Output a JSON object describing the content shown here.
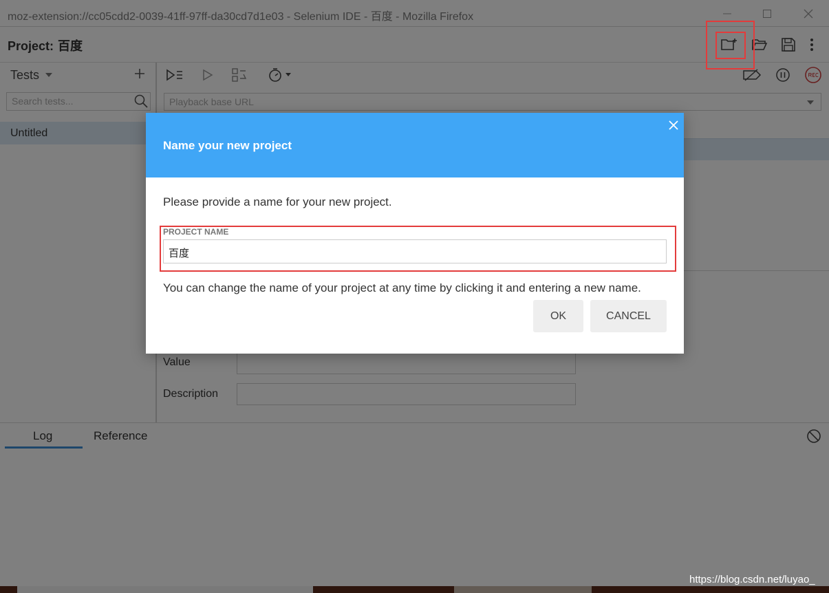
{
  "window": {
    "title": "moz-extension://cc05cdd2-0039-41ff-97ff-da30cd7d1e03 - Selenium IDE - 百度 - Mozilla Firefox"
  },
  "header": {
    "project_label": "Project:",
    "project_name": "百度"
  },
  "sidebar": {
    "tests_label": "Tests",
    "search_placeholder": "Search tests...",
    "items": [
      {
        "label": "Untitled"
      }
    ]
  },
  "main": {
    "base_url_placeholder": "Playback base URL",
    "fields": [
      {
        "label": "Value"
      },
      {
        "label": "Description"
      }
    ]
  },
  "console": {
    "tabs": [
      {
        "label": "Log"
      },
      {
        "label": "Reference"
      }
    ]
  },
  "dialog": {
    "title": "Name your new project",
    "description": "Please provide a name for your new project.",
    "field_label": "PROJECT NAME",
    "field_value": "百度",
    "info": "You can change the name of your project at any time by clicking it and entering a new name.",
    "ok_label": "OK",
    "cancel_label": "CANCEL"
  },
  "watermark": "https://blog.csdn.net/luyao_",
  "colors": {
    "dialog_header": "#40a6f6",
    "selection": "#dbe9f4",
    "highlight_box": "#e33b3b",
    "rec": "#d04040"
  }
}
